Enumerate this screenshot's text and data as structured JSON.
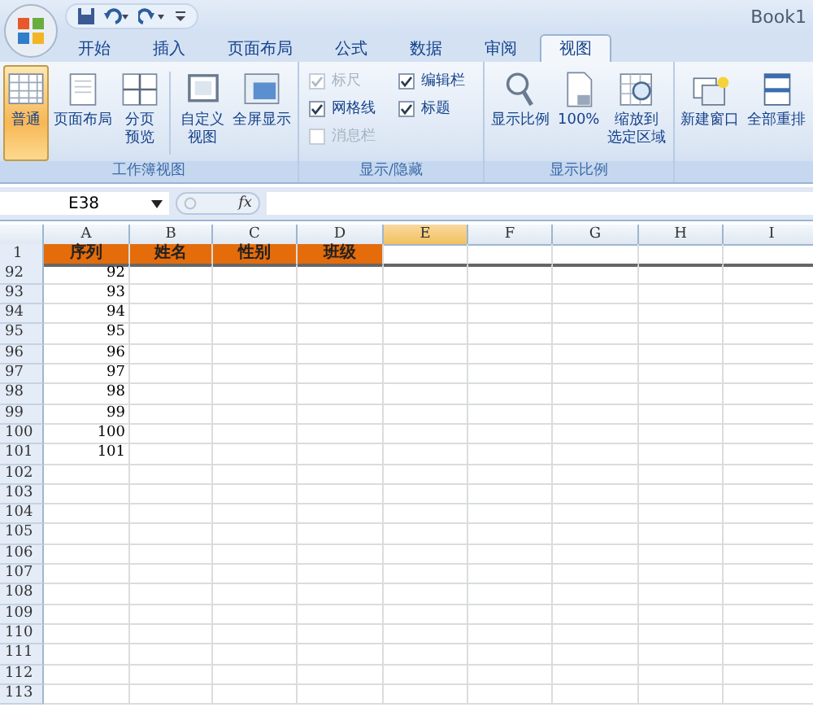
{
  "window": {
    "title": "Book1"
  },
  "tabs": [
    {
      "label": "开始",
      "selected": false
    },
    {
      "label": "插入",
      "selected": false
    },
    {
      "label": "页面布局",
      "selected": false
    },
    {
      "label": "公式",
      "selected": false
    },
    {
      "label": "数据",
      "selected": false
    },
    {
      "label": "审阅",
      "selected": false
    },
    {
      "label": "视图",
      "selected": true
    }
  ],
  "groups": [
    {
      "title": "工作簿视图",
      "items": [
        {
          "kind": "button",
          "lines": [
            "普通"
          ],
          "selected": true
        },
        {
          "kind": "button",
          "lines": [
            "页面布局"
          ],
          "selected": false
        },
        {
          "kind": "button",
          "lines": [
            "分页",
            "预览"
          ],
          "selected": false
        },
        {
          "kind": "separator"
        },
        {
          "kind": "button",
          "lines": [
            "自定义",
            "视图"
          ],
          "selected": false
        },
        {
          "kind": "button",
          "lines": [
            "全屏显示"
          ],
          "selected": false
        }
      ]
    },
    {
      "title": "显示/隐藏",
      "items": [
        {
          "kind": "checks",
          "rows": [
            {
              "label": "标尺",
              "checked": true,
              "disabled": true
            },
            {
              "label": "网格线",
              "checked": true,
              "disabled": false
            },
            {
              "label": "消息栏",
              "checked": false,
              "disabled": true
            }
          ]
        },
        {
          "kind": "checks",
          "rows": [
            {
              "label": "编辑栏",
              "checked": true,
              "disabled": false
            },
            {
              "label": "标题",
              "checked": true,
              "disabled": false
            }
          ]
        }
      ]
    },
    {
      "title": "显示比例",
      "items": [
        {
          "kind": "button",
          "lines": [
            "显示比例"
          ],
          "selected": false
        },
        {
          "kind": "button",
          "lines": [
            "100%"
          ],
          "selected": false
        },
        {
          "kind": "button",
          "lines": [
            "缩放到",
            "选定区域"
          ],
          "selected": false
        }
      ]
    },
    {
      "items": [
        {
          "kind": "button",
          "lines": [
            "新建窗口"
          ],
          "selected": false
        },
        {
          "kind": "button",
          "lines": [
            "全部重排"
          ],
          "selected": false
        }
      ]
    }
  ],
  "formula_bar": {
    "name_box": "E38",
    "function_label": "fx"
  },
  "columns": [
    {
      "label": "A",
      "selected": false
    },
    {
      "label": "B",
      "selected": false
    },
    {
      "label": "C",
      "selected": false
    },
    {
      "label": "D",
      "selected": false
    },
    {
      "label": "E",
      "selected": true
    },
    {
      "label": "F",
      "selected": false
    },
    {
      "label": "G",
      "selected": false
    },
    {
      "label": "H",
      "selected": false
    },
    {
      "label": "I",
      "selected": false
    }
  ],
  "rows": [
    {
      "number": "1",
      "kind": "header",
      "cells": [
        "序列",
        "姓名",
        "性别",
        "班级"
      ]
    },
    {
      "number": "92",
      "kind": "data",
      "cells": [
        "92"
      ]
    },
    {
      "number": "93",
      "kind": "data",
      "cells": [
        "93"
      ]
    },
    {
      "number": "94",
      "kind": "data",
      "cells": [
        "94"
      ]
    },
    {
      "number": "95",
      "kind": "data",
      "cells": [
        "95"
      ]
    },
    {
      "number": "96",
      "kind": "data",
      "cells": [
        "96"
      ]
    },
    {
      "number": "97",
      "kind": "data",
      "cells": [
        "97"
      ]
    },
    {
      "number": "98",
      "kind": "data",
      "cells": [
        "98"
      ]
    },
    {
      "number": "99",
      "kind": "data",
      "cells": [
        "99"
      ]
    },
    {
      "number": "100",
      "kind": "data",
      "cells": [
        "100"
      ]
    },
    {
      "number": "101",
      "kind": "data",
      "cells": [
        "101"
      ]
    },
    {
      "number": "102",
      "kind": "data",
      "cells": []
    },
    {
      "number": "103",
      "kind": "data",
      "cells": []
    },
    {
      "number": "104",
      "kind": "data",
      "cells": []
    },
    {
      "number": "105",
      "kind": "data",
      "cells": []
    },
    {
      "number": "106",
      "kind": "data",
      "cells": []
    },
    {
      "number": "107",
      "kind": "data",
      "cells": []
    },
    {
      "number": "108",
      "kind": "data",
      "cells": []
    },
    {
      "number": "109",
      "kind": "data",
      "cells": []
    },
    {
      "number": "110",
      "kind": "data",
      "cells": []
    },
    {
      "number": "111",
      "kind": "data",
      "cells": []
    },
    {
      "number": "112",
      "kind": "data",
      "cells": []
    },
    {
      "number": "113",
      "kind": "data",
      "cells": []
    }
  ]
}
